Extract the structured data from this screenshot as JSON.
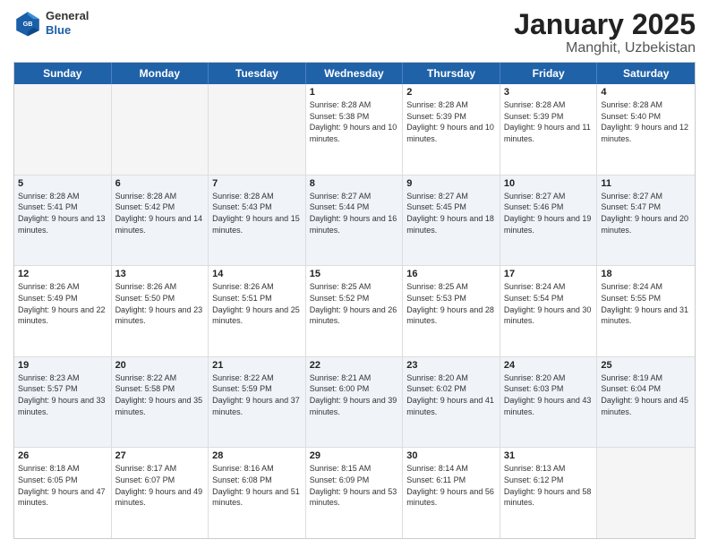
{
  "logo": {
    "general": "General",
    "blue": "Blue"
  },
  "header": {
    "month_year": "January 2025",
    "location": "Manghit, Uzbekistan"
  },
  "days_of_week": [
    "Sunday",
    "Monday",
    "Tuesday",
    "Wednesday",
    "Thursday",
    "Friday",
    "Saturday"
  ],
  "weeks": [
    [
      {
        "day": "",
        "empty": true
      },
      {
        "day": "",
        "empty": true
      },
      {
        "day": "",
        "empty": true
      },
      {
        "day": "1",
        "sunrise": "8:28 AM",
        "sunset": "5:38 PM",
        "daylight": "9 hours and 10 minutes."
      },
      {
        "day": "2",
        "sunrise": "8:28 AM",
        "sunset": "5:39 PM",
        "daylight": "9 hours and 10 minutes."
      },
      {
        "day": "3",
        "sunrise": "8:28 AM",
        "sunset": "5:39 PM",
        "daylight": "9 hours and 11 minutes."
      },
      {
        "day": "4",
        "sunrise": "8:28 AM",
        "sunset": "5:40 PM",
        "daylight": "9 hours and 12 minutes."
      }
    ],
    [
      {
        "day": "5",
        "sunrise": "8:28 AM",
        "sunset": "5:41 PM",
        "daylight": "9 hours and 13 minutes."
      },
      {
        "day": "6",
        "sunrise": "8:28 AM",
        "sunset": "5:42 PM",
        "daylight": "9 hours and 14 minutes."
      },
      {
        "day": "7",
        "sunrise": "8:28 AM",
        "sunset": "5:43 PM",
        "daylight": "9 hours and 15 minutes."
      },
      {
        "day": "8",
        "sunrise": "8:27 AM",
        "sunset": "5:44 PM",
        "daylight": "9 hours and 16 minutes."
      },
      {
        "day": "9",
        "sunrise": "8:27 AM",
        "sunset": "5:45 PM",
        "daylight": "9 hours and 18 minutes."
      },
      {
        "day": "10",
        "sunrise": "8:27 AM",
        "sunset": "5:46 PM",
        "daylight": "9 hours and 19 minutes."
      },
      {
        "day": "11",
        "sunrise": "8:27 AM",
        "sunset": "5:47 PM",
        "daylight": "9 hours and 20 minutes."
      }
    ],
    [
      {
        "day": "12",
        "sunrise": "8:26 AM",
        "sunset": "5:49 PM",
        "daylight": "9 hours and 22 minutes."
      },
      {
        "day": "13",
        "sunrise": "8:26 AM",
        "sunset": "5:50 PM",
        "daylight": "9 hours and 23 minutes."
      },
      {
        "day": "14",
        "sunrise": "8:26 AM",
        "sunset": "5:51 PM",
        "daylight": "9 hours and 25 minutes."
      },
      {
        "day": "15",
        "sunrise": "8:25 AM",
        "sunset": "5:52 PM",
        "daylight": "9 hours and 26 minutes."
      },
      {
        "day": "16",
        "sunrise": "8:25 AM",
        "sunset": "5:53 PM",
        "daylight": "9 hours and 28 minutes."
      },
      {
        "day": "17",
        "sunrise": "8:24 AM",
        "sunset": "5:54 PM",
        "daylight": "9 hours and 30 minutes."
      },
      {
        "day": "18",
        "sunrise": "8:24 AM",
        "sunset": "5:55 PM",
        "daylight": "9 hours and 31 minutes."
      }
    ],
    [
      {
        "day": "19",
        "sunrise": "8:23 AM",
        "sunset": "5:57 PM",
        "daylight": "9 hours and 33 minutes."
      },
      {
        "day": "20",
        "sunrise": "8:22 AM",
        "sunset": "5:58 PM",
        "daylight": "9 hours and 35 minutes."
      },
      {
        "day": "21",
        "sunrise": "8:22 AM",
        "sunset": "5:59 PM",
        "daylight": "9 hours and 37 minutes."
      },
      {
        "day": "22",
        "sunrise": "8:21 AM",
        "sunset": "6:00 PM",
        "daylight": "9 hours and 39 minutes."
      },
      {
        "day": "23",
        "sunrise": "8:20 AM",
        "sunset": "6:02 PM",
        "daylight": "9 hours and 41 minutes."
      },
      {
        "day": "24",
        "sunrise": "8:20 AM",
        "sunset": "6:03 PM",
        "daylight": "9 hours and 43 minutes."
      },
      {
        "day": "25",
        "sunrise": "8:19 AM",
        "sunset": "6:04 PM",
        "daylight": "9 hours and 45 minutes."
      }
    ],
    [
      {
        "day": "26",
        "sunrise": "8:18 AM",
        "sunset": "6:05 PM",
        "daylight": "9 hours and 47 minutes."
      },
      {
        "day": "27",
        "sunrise": "8:17 AM",
        "sunset": "6:07 PM",
        "daylight": "9 hours and 49 minutes."
      },
      {
        "day": "28",
        "sunrise": "8:16 AM",
        "sunset": "6:08 PM",
        "daylight": "9 hours and 51 minutes."
      },
      {
        "day": "29",
        "sunrise": "8:15 AM",
        "sunset": "6:09 PM",
        "daylight": "9 hours and 53 minutes."
      },
      {
        "day": "30",
        "sunrise": "8:14 AM",
        "sunset": "6:11 PM",
        "daylight": "9 hours and 56 minutes."
      },
      {
        "day": "31",
        "sunrise": "8:13 AM",
        "sunset": "6:12 PM",
        "daylight": "9 hours and 58 minutes."
      },
      {
        "day": "",
        "empty": true
      }
    ]
  ]
}
